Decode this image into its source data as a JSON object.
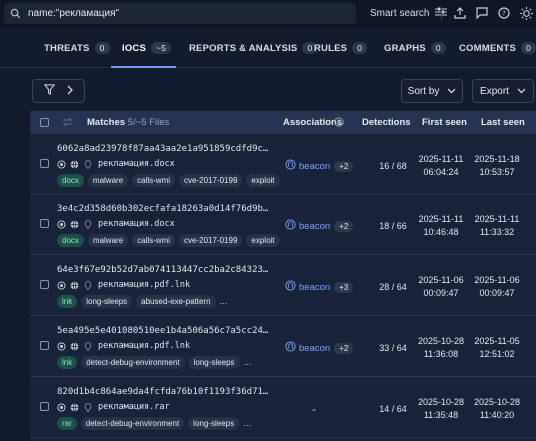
{
  "search": {
    "query": "name:\"рекламация\"",
    "smart_label": "Smart search"
  },
  "tabs": [
    {
      "label": "THREATS",
      "count": "0"
    },
    {
      "label": "IOCS",
      "count": "~5"
    },
    {
      "label": "REPORTS & ANALYSIS",
      "count": "0"
    },
    {
      "label": "RULES",
      "count": "0"
    },
    {
      "label": "GRAPHS",
      "count": "0"
    },
    {
      "label": "COMMENTS",
      "count": "0"
    }
  ],
  "toolbar": {
    "sort_label": "Sort by",
    "export_label": "Export"
  },
  "table": {
    "headers": {
      "matches": "Matches",
      "matches_sub": "- 5/~5 Files",
      "associations": "Associations",
      "detections": "Detections",
      "first_seen": "First seen",
      "last_seen": "Last seen"
    },
    "rows": [
      {
        "hash": "6062a8ad23978f87aa43aa2e1a951859cdfd9c…",
        "filename": "рекламация.docx",
        "tags": [
          "docx",
          "malware",
          "calls-wmi",
          "cve-2017-0199",
          "exploit"
        ],
        "assoc": "beacon",
        "assoc_more": "+2",
        "detections": "16 / 68",
        "first_date": "2025-11-11",
        "first_time": "06:04:24",
        "last_date": "2025-11-18",
        "last_time": "10:53:57"
      },
      {
        "hash": "3e4c2d358d60b302ecfafa18263a0d14f76d9b…",
        "filename": "рекламация.docx",
        "tags": [
          "docx",
          "malware",
          "calls-wmi",
          "cve-2017-0199",
          "exploit"
        ],
        "assoc": "beacon",
        "assoc_more": "+2",
        "detections": "18 / 66",
        "first_date": "2025-11-11",
        "first_time": "10:46:48",
        "last_date": "2025-11-11",
        "last_time": "11:33:32"
      },
      {
        "hash": "64e3f67e92b52d7ab074113447cc2ba2c84323…",
        "filename": "рекламация.pdf.lnk",
        "tags": [
          "lnk",
          "long-sleeps",
          "abused-exe-pattern",
          "…"
        ],
        "assoc": "beacon",
        "assoc_more": "+3",
        "detections": "28 / 64",
        "first_date": "2025-11-06",
        "first_time": "00:09:47",
        "last_date": "2025-11-06",
        "last_time": "00:09:47"
      },
      {
        "hash": "5ea495e5e401080510ee1b4a506a56c7a5cc24…",
        "filename": "рекламация.pdf.lnk",
        "tags": [
          "lnk",
          "detect-debug-environment",
          "long-sleeps",
          "…"
        ],
        "assoc": "beacon",
        "assoc_more": "+2",
        "detections": "33 / 64",
        "first_date": "2025-10-28",
        "first_time": "11:36:08",
        "last_date": "2025-11-05",
        "last_time": "12:51:02"
      },
      {
        "hash": "820d1b4c864ae9da4fcfda76b10f1193f36d71…",
        "filename": "рекламация.rar",
        "tags": [
          "rar",
          "detect-debug-environment",
          "long-sleeps",
          "…"
        ],
        "assoc": "-",
        "assoc_more": "",
        "detections": "14 / 64",
        "first_date": "2025-10-28",
        "first_time": "11:35:48",
        "last_date": "2025-10-28",
        "last_time": "11:40:20"
      }
    ]
  }
}
